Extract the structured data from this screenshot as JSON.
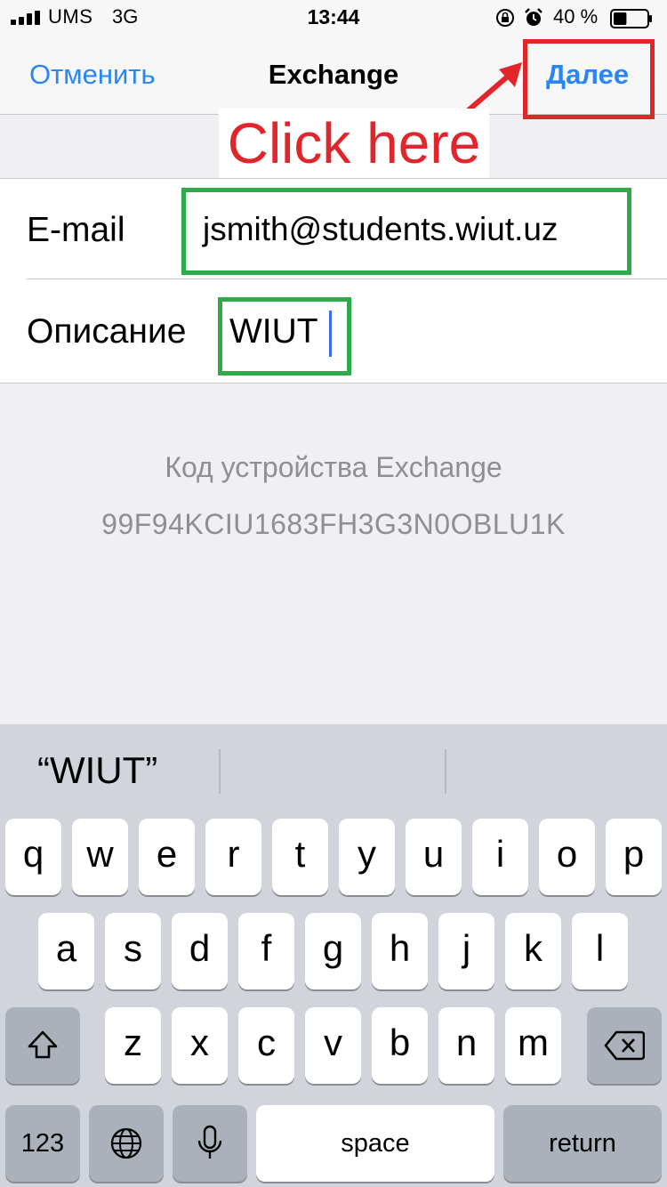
{
  "status_bar": {
    "carrier": "UMS",
    "network": "3G",
    "time": "13:44",
    "battery_text": "40 %",
    "battery_level": 0.4,
    "icons": [
      "signal-bars-icon",
      "rotation-lock-icon",
      "alarm-icon",
      "battery-icon"
    ]
  },
  "nav": {
    "cancel_label": "Отменить",
    "title": "Exchange",
    "next_label": "Далее"
  },
  "annotation": {
    "label": "Click here",
    "highlight_color": "#e0252b",
    "field_highlight_color": "#2eaa4a"
  },
  "form": {
    "email_label": "E-mail",
    "email_value": "jsmith@students.wiut.uz",
    "description_label": "Описание",
    "description_value": "WIUT"
  },
  "device": {
    "title": "Код устройства Exchange",
    "code": "99F94KCIU1683FH3G3N0OBLU1K"
  },
  "keyboard": {
    "suggestion": "“WIUT”",
    "row1": [
      "q",
      "w",
      "e",
      "r",
      "t",
      "y",
      "u",
      "i",
      "o",
      "p"
    ],
    "row2": [
      "a",
      "s",
      "d",
      "f",
      "g",
      "h",
      "j",
      "k",
      "l"
    ],
    "row3": [
      "z",
      "x",
      "c",
      "v",
      "b",
      "n",
      "m"
    ],
    "numbers_label": "123",
    "space_label": "space",
    "return_label": "return"
  },
  "colors": {
    "accent": "#2a86f5",
    "secondary_text": "#8e8e93",
    "caret": "#3b6cf0"
  }
}
